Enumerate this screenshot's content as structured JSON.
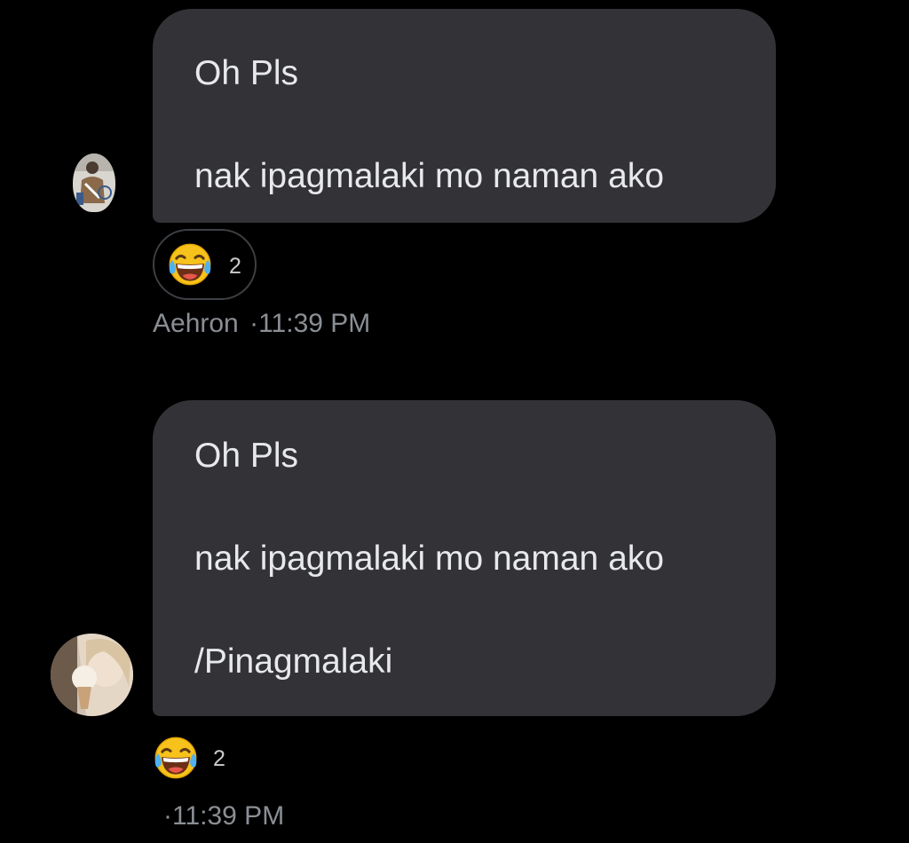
{
  "messages": [
    {
      "lines": [
        "Oh Pls",
        "nak ipagmalaki mo naman ako"
      ],
      "reaction": {
        "emoji": "face-with-tears-of-joy",
        "count": "2"
      },
      "sender": "Aehron",
      "separator": "·",
      "time": "11:39 PM"
    },
    {
      "lines": [
        "Oh Pls",
        "nak ipagmalaki mo naman ako",
        "/Pinagmalaki"
      ],
      "reaction": {
        "emoji": "face-with-tears-of-joy",
        "count": "2"
      },
      "separator": "·",
      "time": "11:39 PM"
    }
  ],
  "colors": {
    "background": "#000000",
    "bubble": "#333337",
    "text": "#e7e9ea",
    "meta": "#8b8f94"
  }
}
